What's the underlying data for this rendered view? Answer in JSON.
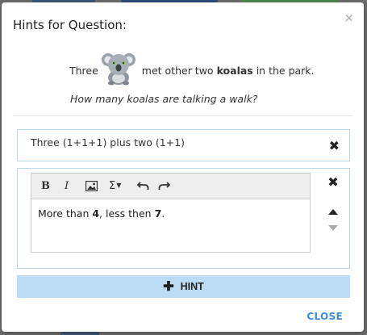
{
  "modal": {
    "title": "Hints for Question:",
    "close_symbol": "×"
  },
  "question": {
    "before": "Three",
    "after_normal": " met other two ",
    "after_bold": "koalas",
    "after_end": " in the park.",
    "image_icon": "koala-icon",
    "italic": "How many koalas are talking a walk?"
  },
  "hints": [
    {
      "text": "Three (1+1+1) plus two (1+1)"
    }
  ],
  "editor": {
    "toolbar": {
      "bold": "B",
      "italic": "I",
      "image_icon": "image-icon",
      "math": "Σ",
      "undo_icon": "undo-icon",
      "redo_icon": "redo-icon"
    },
    "content": {
      "p1": "More than ",
      "b1": "4",
      "p2": ", less then ",
      "b2": "7",
      "p3": "."
    }
  },
  "add_hint_label": "HINT",
  "close_label": "CLOSE",
  "colors": {
    "accent": "#3b8ed8",
    "hint_border": "#b9d6ea",
    "add_hint_bg": "#bcdcf5"
  }
}
